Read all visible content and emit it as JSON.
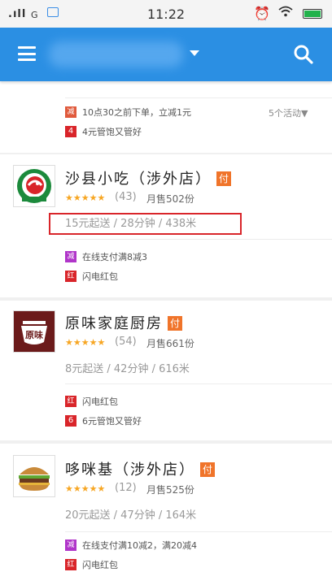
{
  "status_bar": {
    "signal": ".ıll",
    "network": "G",
    "time": "11:22"
  },
  "colors": {
    "app_bar": "#2b8fe3",
    "rating_star": "#f7a623",
    "pay_badge": "#f0742a",
    "highlight": "#d9252a"
  },
  "icons": [
    "menu-icon",
    "dropdown-caret-icon",
    "search-icon",
    "alarm-icon",
    "wifi-icon",
    "battery-icon"
  ],
  "top_card": {
    "promotions": [
      {
        "badge": "减",
        "text": "10点30之前下单，立减1元"
      },
      {
        "badge": "4",
        "text": "4元管饱又管好"
      }
    ],
    "activities_label": "5个活动▼"
  },
  "restaurants": [
    {
      "name": "沙县小吃（涉外店）",
      "pay_badge": "付",
      "stars": "★★★★★",
      "rating": 4.5,
      "rating_count": "(43)",
      "monthly_sales": "月售502份",
      "delivery_info": "15元起送 / 28分钟 / 438米",
      "promotions": [
        {
          "badge": "减",
          "text": "在线支付满8减3"
        },
        {
          "badge": "红",
          "text": "闪电红包"
        }
      ]
    },
    {
      "name": "原味家庭厨房",
      "pay_badge": "付",
      "logo_text": "原味",
      "stars": "★★★★★",
      "rating": 4.5,
      "rating_count": "(54)",
      "monthly_sales": "月售661份",
      "delivery_info": "8元起送 / 42分钟 / 616米",
      "promotions": [
        {
          "badge": "红",
          "text": "闪电红包"
        },
        {
          "badge": "6",
          "text": "6元管饱又管好"
        }
      ]
    },
    {
      "name": "哆咪基（涉外店）",
      "pay_badge": "付",
      "stars": "★★★★★",
      "rating": 5,
      "rating_count": "(12)",
      "monthly_sales": "月售525份",
      "delivery_info": "20元起送 / 47分钟 / 164米",
      "promotions": [
        {
          "badge": "减",
          "text": "在线支付满10减2，满20减4"
        },
        {
          "badge": "红",
          "text": "闪电红包"
        }
      ]
    }
  ]
}
